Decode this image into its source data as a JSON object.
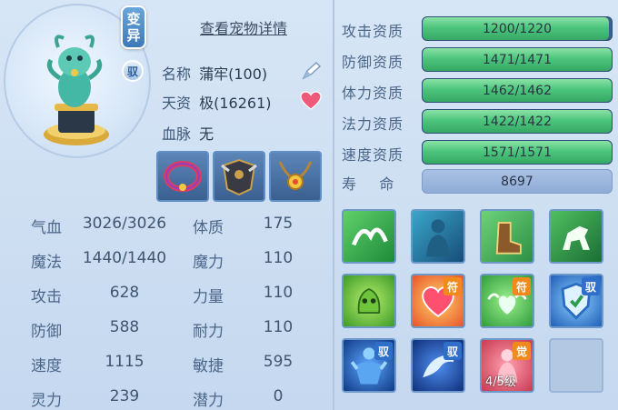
{
  "pet": {
    "mutation_badge": "变\n异",
    "mutation_chars": [
      "变",
      "异"
    ],
    "tame_badge": "驭",
    "details_link": "查看宠物详情",
    "name_label": "名称",
    "name_value": "蒲牢(100)",
    "aptitude_label": "天资",
    "aptitude_value": "极(16261)",
    "bloodline_label": "血脉",
    "bloodline_value": "无"
  },
  "equipment": [
    {
      "name": "collar"
    },
    {
      "name": "armor"
    },
    {
      "name": "necklace"
    }
  ],
  "stats": [
    {
      "label": "气血",
      "value": "3026/3026",
      "label2": "体质",
      "value2": "175"
    },
    {
      "label": "魔法",
      "value": "1440/1440",
      "label2": "魔力",
      "value2": "110"
    },
    {
      "label": "攻击",
      "value": "628",
      "label2": "力量",
      "value2": "110"
    },
    {
      "label": "防御",
      "value": "588",
      "label2": "耐力",
      "value2": "110"
    },
    {
      "label": "速度",
      "value": "1115",
      "label2": "敏捷",
      "value2": "595"
    },
    {
      "label": "灵力",
      "value": "239",
      "label2": "潜力",
      "value2": "0"
    }
  ],
  "aptitudes": [
    {
      "label": "攻击资质",
      "text": "1200/1220",
      "fill": 0.9836
    },
    {
      "label": "防御资质",
      "text": "1471/1471",
      "fill": 1.0
    },
    {
      "label": "体力资质",
      "text": "1462/1462",
      "fill": 1.0
    },
    {
      "label": "法力资质",
      "text": "1422/1422",
      "fill": 1.0
    },
    {
      "label": "速度资质",
      "text": "1571/1571",
      "fill": 1.0
    }
  ],
  "lifespan": {
    "label": "寿    命",
    "value": "8697"
  },
  "skills": [
    {
      "name": "wings",
      "tag": ""
    },
    {
      "name": "shadow-figure",
      "tag": ""
    },
    {
      "name": "boots",
      "tag": ""
    },
    {
      "name": "horse",
      "tag": ""
    },
    {
      "name": "bell-guardian",
      "tag": ""
    },
    {
      "name": "heart-glow",
      "tag": "符"
    },
    {
      "name": "winged-heart",
      "tag": "符"
    },
    {
      "name": "shield",
      "tag": "驭"
    },
    {
      "name": "muscle-warrior",
      "tag": "驭"
    },
    {
      "name": "dolphin-leap",
      "tag": "驭"
    },
    {
      "name": "awakened-warrior",
      "tag": "觉",
      "level": "4/5级"
    },
    {
      "name": "empty-slot",
      "tag": ""
    }
  ],
  "colors": {
    "bar_green": "#4dc57d",
    "tag_orange": "#f08a1c",
    "tag_blue": "#2f6fc9"
  }
}
